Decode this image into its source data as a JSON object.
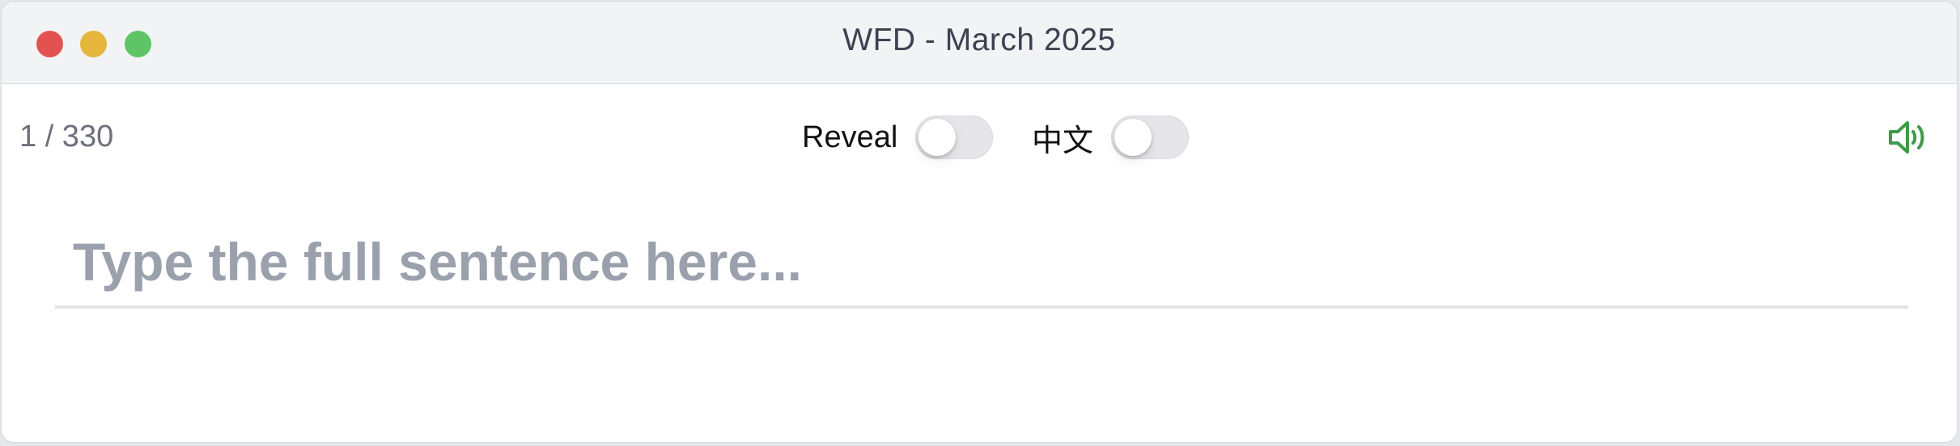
{
  "window": {
    "title": "WFD - March 2025"
  },
  "toolbar": {
    "counter": "1 / 330",
    "reveal_label": "Reveal",
    "reveal_on": false,
    "chinese_label": "中文",
    "chinese_on": false,
    "speaker_icon": "speaker-volume-icon",
    "accent_color": "#3f9b4a"
  },
  "input": {
    "value": "",
    "placeholder": "Type the full sentence here..."
  }
}
